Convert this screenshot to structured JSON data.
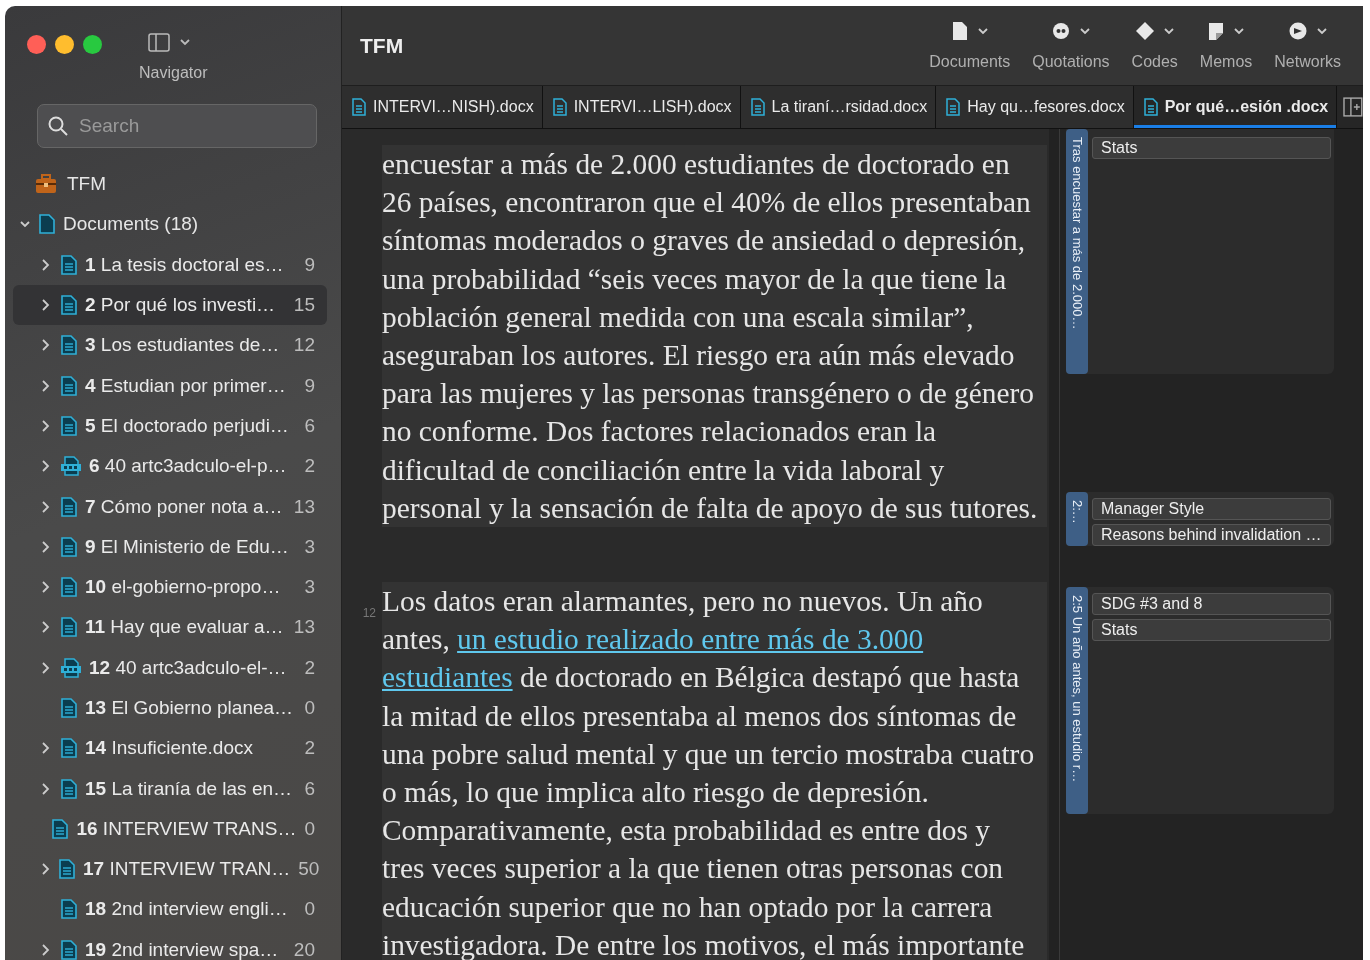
{
  "window": {
    "title": "TFM"
  },
  "navigator": {
    "label": "Navigator"
  },
  "search": {
    "placeholder": "Search"
  },
  "tree": {
    "project": "TFM",
    "group": {
      "label": "Documents (18)",
      "expanded": true
    },
    "items": [
      {
        "number": "1",
        "name": "La tesis doctoral es…",
        "count": "9",
        "kind": "doc",
        "expanded": false,
        "selected": false
      },
      {
        "number": "2",
        "name": "Por qué los investi…",
        "count": "15",
        "kind": "doc",
        "expanded": false,
        "selected": true
      },
      {
        "number": "3",
        "name": "Los estudiantes de…",
        "count": "12",
        "kind": "doc",
        "expanded": false,
        "selected": false
      },
      {
        "number": "4",
        "name": "Estudian por primer…",
        "count": "9",
        "kind": "doc",
        "expanded": false,
        "selected": false
      },
      {
        "number": "5",
        "name": "El doctorado perjudi…",
        "count": "6",
        "kind": "doc",
        "expanded": false,
        "selected": false
      },
      {
        "number": "6",
        "name": "40 artc3adculo-el-p…",
        "count": "2",
        "kind": "pdf",
        "expanded": false,
        "selected": false
      },
      {
        "number": "7",
        "name": "Cómo poner nota a…",
        "count": "13",
        "kind": "doc",
        "expanded": false,
        "selected": false
      },
      {
        "number": "9",
        "name": "El Ministerio de Edu…",
        "count": "3",
        "kind": "doc",
        "expanded": false,
        "selected": false
      },
      {
        "number": "10",
        "name": "el-gobierno-propo…",
        "count": "3",
        "kind": "doc",
        "expanded": false,
        "selected": false
      },
      {
        "number": "11",
        "name": "Hay que evaluar a…",
        "count": "13",
        "kind": "doc",
        "expanded": false,
        "selected": false
      },
      {
        "number": "12",
        "name": "40 artc3adculo-el-…",
        "count": "2",
        "kind": "pdf",
        "expanded": false,
        "selected": false
      },
      {
        "number": "13",
        "name": "El Gobierno planea…",
        "count": "0",
        "kind": "doc",
        "selected": false
      },
      {
        "number": "14",
        "name": "Insuficiente.docx",
        "count": "2",
        "kind": "doc",
        "expanded": false,
        "selected": false
      },
      {
        "number": "15",
        "name": "La tiranía de las en…",
        "count": "6",
        "kind": "doc",
        "expanded": false,
        "selected": false
      },
      {
        "number": "16",
        "name": "INTERVIEW TRANS…",
        "count": "0",
        "kind": "doc",
        "selected": false
      },
      {
        "number": "17",
        "name": "INTERVIEW TRAN…",
        "count": "50",
        "kind": "doc",
        "expanded": false,
        "selected": false
      },
      {
        "number": "18",
        "name": "2nd interview engli…",
        "count": "0",
        "kind": "doc",
        "selected": false
      },
      {
        "number": "19",
        "name": "2nd interview spa…",
        "count": "20",
        "kind": "doc",
        "expanded": false,
        "selected": false
      }
    ]
  },
  "toolbar": [
    {
      "label": "Documents",
      "kind": "documents"
    },
    {
      "label": "Quotations",
      "kind": "quotations"
    },
    {
      "label": "Codes",
      "kind": "codes"
    },
    {
      "label": "Memos",
      "kind": "memos"
    },
    {
      "label": "Networks",
      "kind": "networks"
    }
  ],
  "tabs": [
    {
      "label": "INTERVI…NISH).docx",
      "selected": false
    },
    {
      "label": "INTERVI…LISH).docx",
      "selected": false
    },
    {
      "label": "La tiraní…rsidad.docx",
      "selected": false
    },
    {
      "label": "Hay qu…fesores.docx",
      "selected": false
    },
    {
      "label": "Por qué…esión .docx",
      "selected": true
    }
  ],
  "editor": {
    "paragraphs": [
      {
        "before": "encuestar a más de 2.000 estudiantes de doctorado en 26 países, encontraron que el 40% de ellos presentaban síntomas moderados o graves de ansiedad o depresión, una probabilidad “seis veces mayor de la que tiene la población general medida con una escala similar”, aseguraban los autores. El riesgo era aún más elevado para las mujeres y las personas transgénero o de género no conforme. Dos factores relacionados eran la dificultad de conciliación entre la vida laboral y personal y la sensación de falta de apoyo de sus tutores."
      },
      {
        "number": "12",
        "before": "Los datos eran alarmantes, pero no nuevos. Un año antes,",
        "link": [
          "un estudio realizado entre más de 3.000",
          "estudiantes"
        ],
        "after": "de doctorado en Bélgica destapó que hasta la mitad de ellos presentaba al menos dos síntomas de una pobre salud mental y que un tercio mostraba cuatro o más, lo que implica alto riesgo de depresión. Comparativamente, esta probabilidad es entre dos y tres veces superior a la que tienen otras personas con educación superior que no han optado por la carrera investigadora. De entre los motivos, el más importante"
      }
    ]
  },
  "margin": [
    {
      "label": "Tras encuestar a más de 2.000…",
      "codes": [
        "Stats"
      ]
    },
    {
      "label": "2:…",
      "codes": [
        "Manager Style",
        "Reasons behind invalidation …"
      ]
    },
    {
      "label": "2:5 Un año antes, un estudio r…",
      "codes": [
        "SDG #3 and 8",
        "Stats"
      ]
    }
  ]
}
